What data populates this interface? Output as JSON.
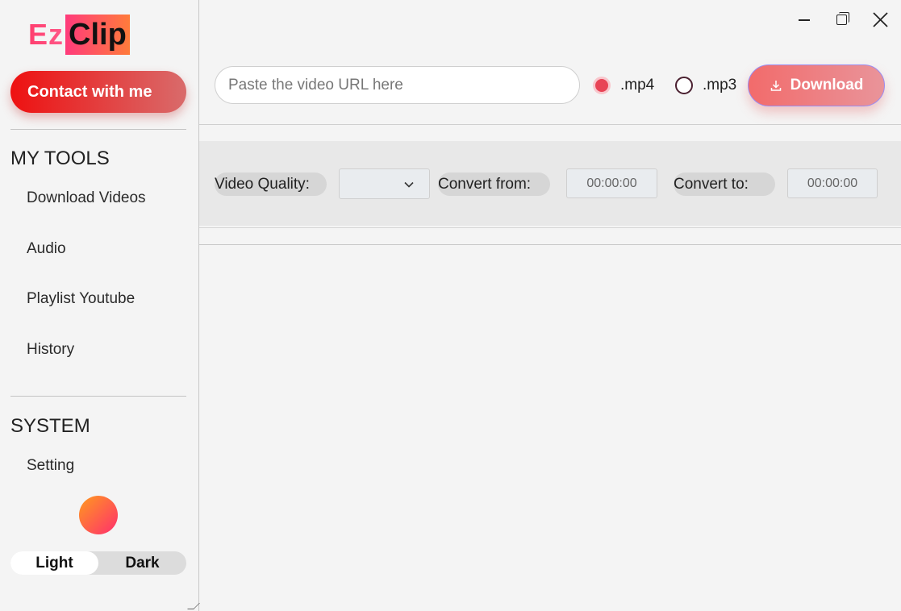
{
  "logo": {
    "part1": "Ez",
    "part2": "Clip"
  },
  "sidebar": {
    "contact_label": "Contact with me",
    "tools_title": "MY TOOLS",
    "tools": [
      {
        "label": "Download Videos"
      },
      {
        "label": "Audio"
      },
      {
        "label": "Playlist Youtube"
      },
      {
        "label": "History"
      }
    ],
    "system_title": "SYSTEM",
    "system_items": [
      {
        "label": "Setting"
      }
    ],
    "theme": {
      "light_label": "Light",
      "dark_label": "Dark",
      "selected": "Light"
    }
  },
  "toolbar": {
    "url_placeholder": "Paste the video URL here",
    "url_value": "",
    "formats": [
      {
        "label": ".mp4",
        "selected": true
      },
      {
        "label": ".mp3",
        "selected": false
      }
    ],
    "download_label": "Download"
  },
  "options": {
    "quality_label": "Video Quality:",
    "quality_value": "",
    "convert_from_label": "Convert from:",
    "convert_from_value": "00:00:00",
    "convert_to_label": "Convert to:",
    "convert_to_value": "00:00:00"
  },
  "colors": {
    "accent": "#ee1111",
    "download_gradient_start": "#f26b6b",
    "radio_selected": "#e84355",
    "theme_dot_start": "#ff9a1e",
    "theme_dot_end": "#ff2e6e"
  },
  "icons": {
    "minimize": "minimize-icon",
    "maximize": "maximize-icon",
    "close": "close-icon",
    "download": "download-icon",
    "dropdown": "chevron-down-icon"
  }
}
